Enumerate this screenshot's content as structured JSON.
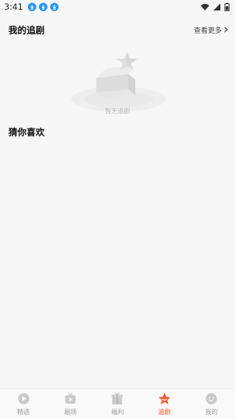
{
  "status_bar": {
    "time": "3:41",
    "notification_icons": [
      "download-icon",
      "download-icon",
      "download-icon"
    ],
    "right_icons": [
      "wifi-icon",
      "signal-icon",
      "battery-icon"
    ]
  },
  "my_follow": {
    "title": "我的追剧",
    "see_more": "查看更多",
    "empty_text": "暂无追剧"
  },
  "guess": {
    "title": "猜你喜欢"
  },
  "tabbar": {
    "tabs": [
      {
        "label": "精选",
        "icon": "play-circle-icon",
        "active": false
      },
      {
        "label": "剧场",
        "icon": "tv-icon",
        "active": false
      },
      {
        "label": "福利",
        "icon": "gift-icon",
        "active": false
      },
      {
        "label": "追剧",
        "icon": "star-badge-icon",
        "active": true
      },
      {
        "label": "我的",
        "icon": "smiley-icon",
        "active": false
      }
    ]
  },
  "colors": {
    "accent": "#ff5b2e",
    "inactive": "#9a9a9a",
    "background": "#f7f7f7",
    "status_icon": "#2196f3"
  }
}
